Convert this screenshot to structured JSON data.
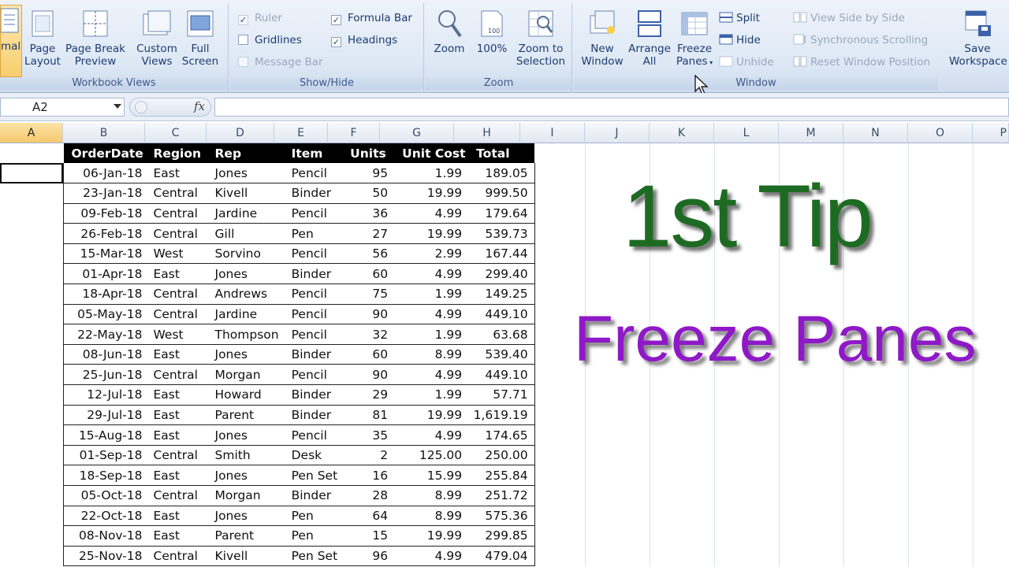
{
  "ribbon": {
    "workbook_views": {
      "group_label": "Workbook Views",
      "buttons": [
        {
          "label1": "mal",
          "label2": ""
        },
        {
          "label1": "Page",
          "label2": "Layout"
        },
        {
          "label1": "Page Break",
          "label2": "Preview"
        },
        {
          "label1": "Custom",
          "label2": "Views"
        },
        {
          "label1": "Full",
          "label2": "Screen"
        }
      ]
    },
    "show_hide": {
      "group_label": "Show/Hide",
      "ruler": "Ruler",
      "gridlines": "Gridlines",
      "message_bar": "Message Bar",
      "formula_bar": "Formula Bar",
      "headings": "Headings"
    },
    "zoom": {
      "group_label": "Zoom",
      "zoom": "Zoom",
      "hundred": "100%",
      "zoom_sel1": "Zoom to",
      "zoom_sel2": "Selection"
    },
    "window": {
      "group_label": "Window",
      "new_window1": "New",
      "new_window2": "Window",
      "arrange1": "Arrange",
      "arrange2": "All",
      "freeze1": "Freeze",
      "freeze2": "Panes",
      "split": "Split",
      "hide": "Hide",
      "unhide": "Unhide",
      "side_by_side": "View Side by Side",
      "sync_scroll": "Synchronous Scrolling",
      "reset_pos": "Reset Window Position",
      "save1": "Save",
      "save2": "Workspace"
    }
  },
  "formula_bar": {
    "name_box": "A2",
    "fx": "fx"
  },
  "columns": [
    "A",
    "B",
    "C",
    "D",
    "E",
    "F",
    "G",
    "H",
    "I",
    "J",
    "K",
    "L",
    "M",
    "N",
    "O",
    "P"
  ],
  "table": {
    "headers": [
      "OrderDate",
      "Region",
      "Rep",
      "Item",
      "Units",
      "Unit Cost",
      "Total"
    ],
    "rows": [
      [
        "06-Jan-18",
        "East",
        "Jones",
        "Pencil",
        "95",
        "1.99",
        "189.05"
      ],
      [
        "23-Jan-18",
        "Central",
        "Kivell",
        "Binder",
        "50",
        "19.99",
        "999.50"
      ],
      [
        "09-Feb-18",
        "Central",
        "Jardine",
        "Pencil",
        "36",
        "4.99",
        "179.64"
      ],
      [
        "26-Feb-18",
        "Central",
        "Gill",
        "Pen",
        "27",
        "19.99",
        "539.73"
      ],
      [
        "15-Mar-18",
        "West",
        "Sorvino",
        "Pencil",
        "56",
        "2.99",
        "167.44"
      ],
      [
        "01-Apr-18",
        "East",
        "Jones",
        "Binder",
        "60",
        "4.99",
        "299.40"
      ],
      [
        "18-Apr-18",
        "Central",
        "Andrews",
        "Pencil",
        "75",
        "1.99",
        "149.25"
      ],
      [
        "05-May-18",
        "Central",
        "Jardine",
        "Pencil",
        "90",
        "4.99",
        "449.10"
      ],
      [
        "22-May-18",
        "West",
        "Thompson",
        "Pencil",
        "32",
        "1.99",
        "63.68"
      ],
      [
        "08-Jun-18",
        "East",
        "Jones",
        "Binder",
        "60",
        "8.99",
        "539.40"
      ],
      [
        "25-Jun-18",
        "Central",
        "Morgan",
        "Pencil",
        "90",
        "4.99",
        "449.10"
      ],
      [
        "12-Jul-18",
        "East",
        "Howard",
        "Binder",
        "29",
        "1.99",
        "57.71"
      ],
      [
        "29-Jul-18",
        "East",
        "Parent",
        "Binder",
        "81",
        "19.99",
        "1,619.19"
      ],
      [
        "15-Aug-18",
        "East",
        "Jones",
        "Pencil",
        "35",
        "4.99",
        "174.65"
      ],
      [
        "01-Sep-18",
        "Central",
        "Smith",
        "Desk",
        "2",
        "125.00",
        "250.00"
      ],
      [
        "18-Sep-18",
        "East",
        "Jones",
        "Pen Set",
        "16",
        "15.99",
        "255.84"
      ],
      [
        "05-Oct-18",
        "Central",
        "Morgan",
        "Binder",
        "28",
        "8.99",
        "251.72"
      ],
      [
        "22-Oct-18",
        "East",
        "Jones",
        "Pen",
        "64",
        "8.99",
        "575.36"
      ],
      [
        "08-Nov-18",
        "East",
        "Parent",
        "Pen",
        "15",
        "19.99",
        "299.85"
      ],
      [
        "25-Nov-18",
        "Central",
        "Kivell",
        "Pen Set",
        "96",
        "4.99",
        "479.04"
      ]
    ]
  },
  "overlay": {
    "line1": "1st Tip",
    "line2": "Freeze Panes"
  },
  "colors": {
    "tip_green": "#1d6b22",
    "tip_purple": "#8f18c8",
    "header_fill": "#000000"
  }
}
